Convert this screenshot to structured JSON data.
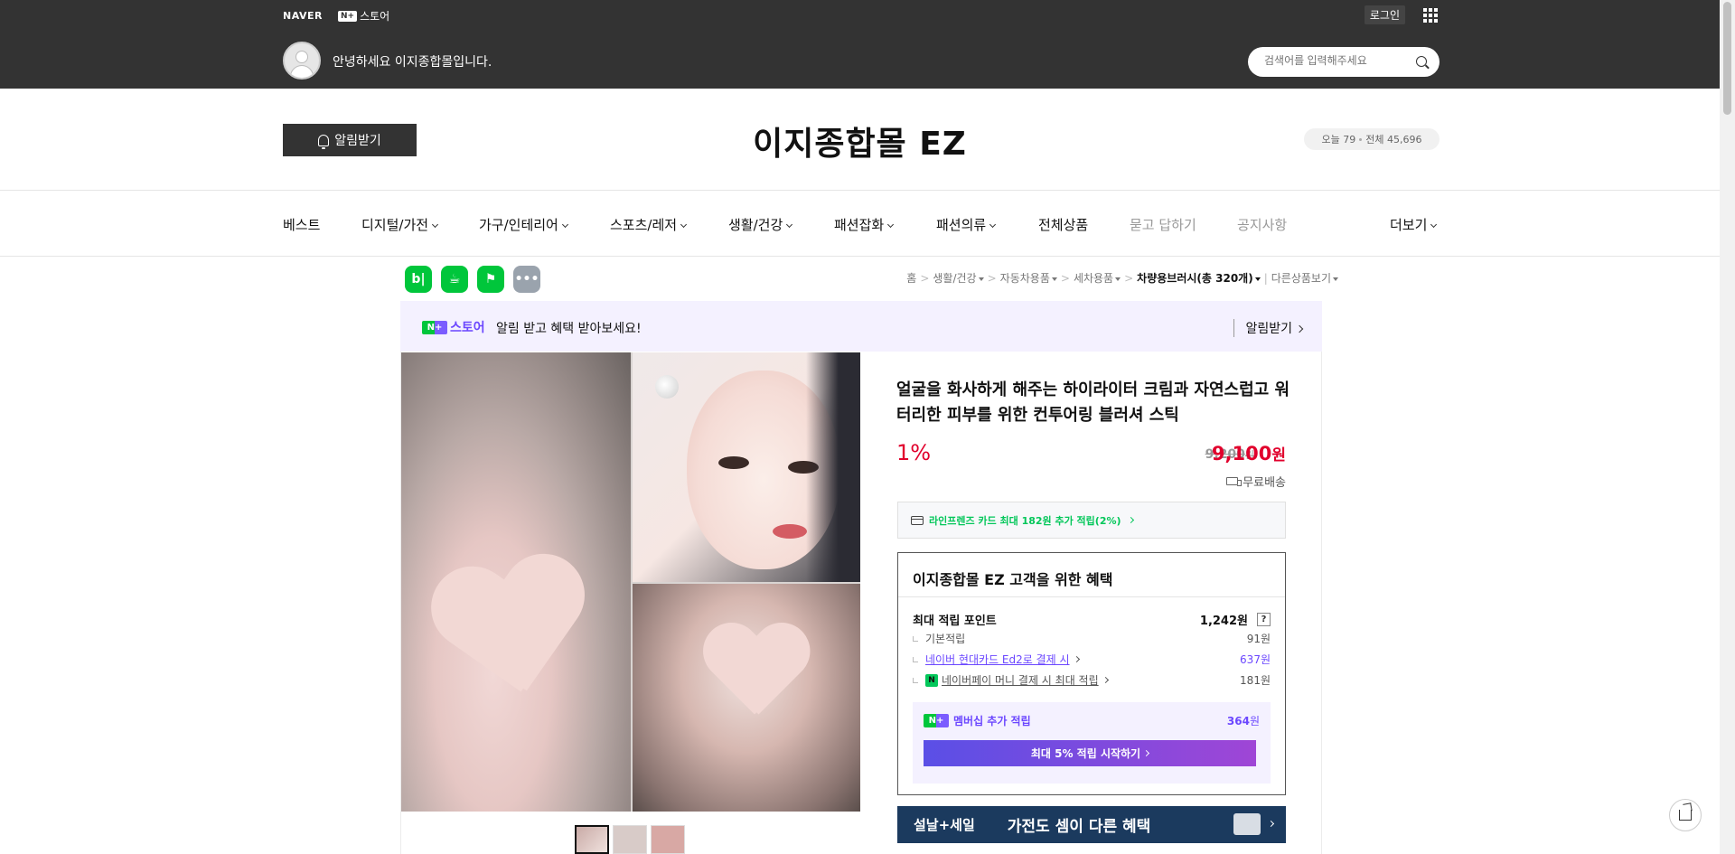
{
  "topbar": {
    "naver": "NAVER",
    "nstore_box": "N+",
    "nstore": "스토어",
    "login": "로그인",
    "greeting": "안녕하세요 이지종합몰입니다.",
    "search_placeholder": "검색어를 입력해주세요"
  },
  "header": {
    "alarm": "알림받기",
    "store_title": "이지종합몰 EZ",
    "today_label": "오늘 79",
    "total_label": "전체 45,696"
  },
  "nav": {
    "items": [
      "베스트",
      "디지털/가전",
      "가구/인테리어",
      "스포츠/레저",
      "생활/건강",
      "패션잡화",
      "패션의류",
      "전체상품",
      "묻고 답하기",
      "공지사항",
      "더보기"
    ]
  },
  "share": {
    "blog": "b|",
    "cafe": "☕",
    "bookmark": "⚑",
    "more": "•••"
  },
  "breadcrumb": {
    "home": "홈",
    "c1": "생활/건강",
    "c2": "자동차용품",
    "c3": "세차용품",
    "c4": "차량용브러시(총 320개)",
    "c5": "다른상품보기"
  },
  "promo": {
    "nbox": "N+",
    "store": "스토어",
    "message": "알림 받고 혜택 받아보세요!",
    "link": "알림받기"
  },
  "product": {
    "title": "얼굴을 화사하게 해주는 하이라이터 크림과 자연스럽고 워터리한 피부를 위한 컨투어링 블러셔 스틱",
    "discount": "1%",
    "old_price": "9,200",
    "old_unit": "원",
    "price": "9,100",
    "price_unit": "원",
    "shipping": "무료배송"
  },
  "card_benefit": "라인프렌즈 카드 최대 182원 추가 적립(2%)",
  "benefit_box": {
    "title": "이지종합몰 EZ 고객을 위한 혜택",
    "max_points_label": "최대 적립 포인트",
    "max_points_value": "1,242원",
    "basic_label": "기본적립",
    "basic_value": "91원",
    "hyundai_label": "네이버 현대카드 Ed2로 결제 시",
    "hyundai_value": "637원",
    "npay_label": "네이버페이 머니 결제 시 최대 적립",
    "npay_value": "181원",
    "membership_label": "멤버십 추가 적립",
    "membership_value": "364",
    "membership_unit": "원",
    "membership_button": "최대 5% 적립 시작하기"
  },
  "banner": {
    "tag": "설날+세일",
    "text": "가전도 셈이 다른 혜택"
  }
}
